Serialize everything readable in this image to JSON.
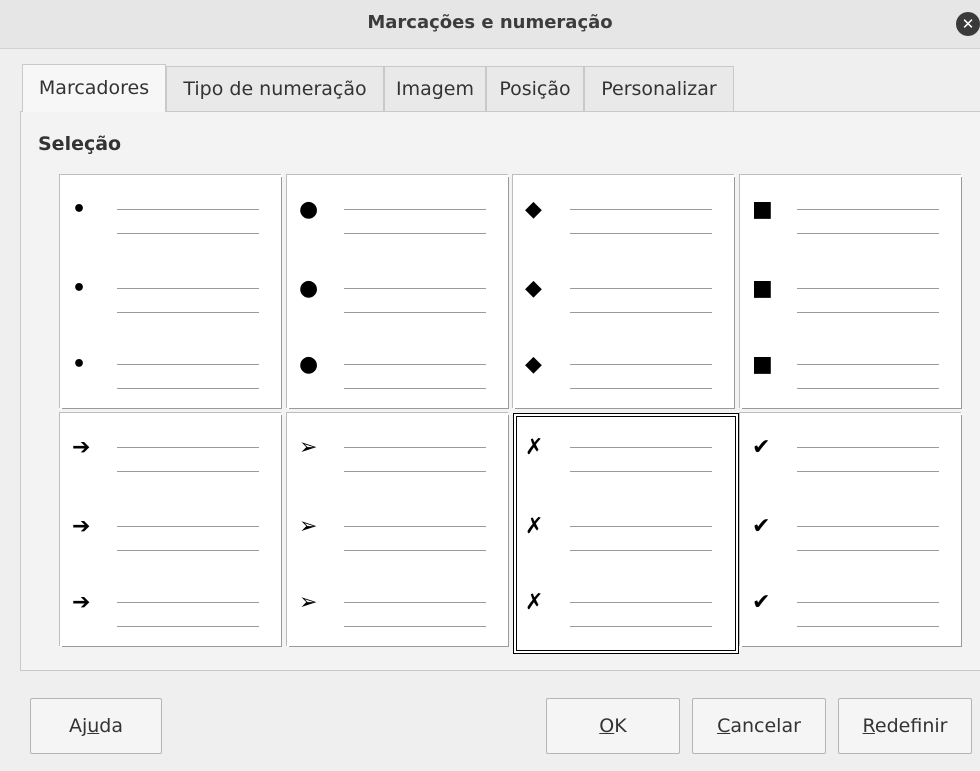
{
  "dialog": {
    "title": "Marcações e numeração",
    "close_icon": "close-icon"
  },
  "tabs": [
    {
      "label": "Marcadores",
      "active": true
    },
    {
      "label": "Tipo de numeração",
      "active": false
    },
    {
      "label": "Imagem",
      "active": false
    },
    {
      "label": "Posição",
      "active": false
    },
    {
      "label": "Personalizar",
      "active": false
    }
  ],
  "selection": {
    "label": "Seleção",
    "styles": [
      {
        "name": "small-dot",
        "glyph": "•",
        "selected": false
      },
      {
        "name": "large-dot",
        "glyph": "●",
        "selected": false
      },
      {
        "name": "diamond",
        "glyph": "◆",
        "selected": false
      },
      {
        "name": "square",
        "glyph": "■",
        "selected": false
      },
      {
        "name": "arrow",
        "glyph": "➔",
        "selected": false
      },
      {
        "name": "arrowhead",
        "glyph": "➢",
        "selected": false
      },
      {
        "name": "x-mark",
        "glyph": "✗",
        "selected": true
      },
      {
        "name": "check-mark",
        "glyph": "✔",
        "selected": false
      }
    ]
  },
  "buttons": {
    "help": {
      "pre": "Aj",
      "accel": "u",
      "post": "da"
    },
    "ok": {
      "pre": "",
      "accel": "O",
      "post": "K"
    },
    "cancel": {
      "pre": "",
      "accel": "C",
      "post": "ancelar"
    },
    "reset": {
      "pre": "",
      "accel": "R",
      "post": "edefinir"
    }
  }
}
